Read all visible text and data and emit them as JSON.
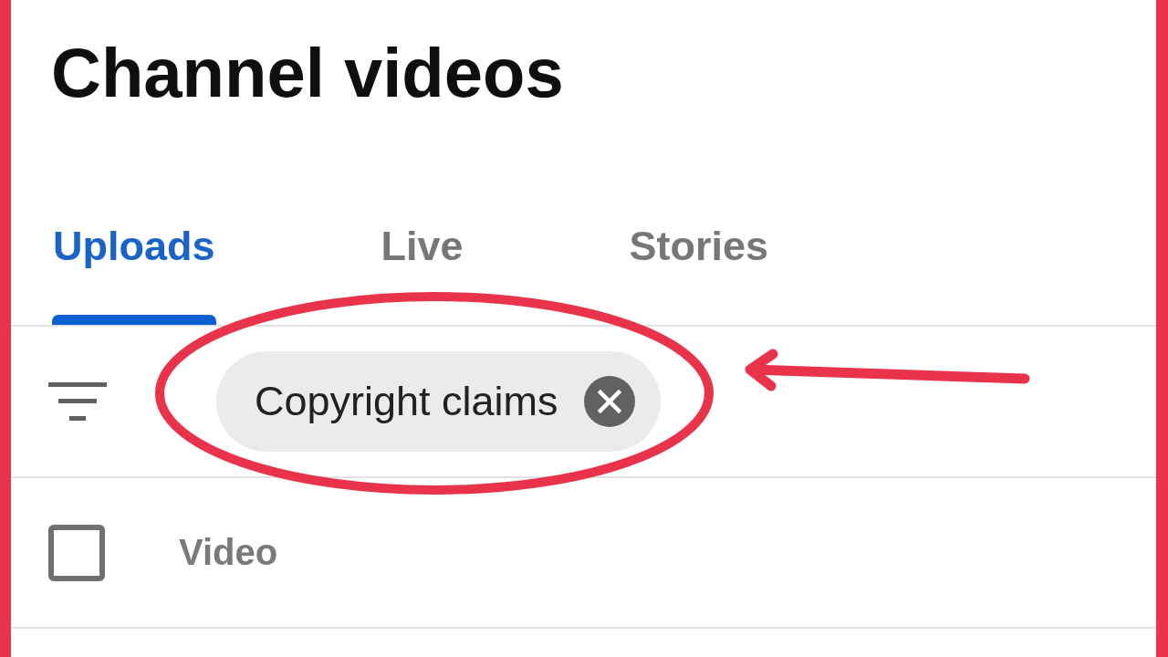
{
  "title": "Channel videos",
  "tabs": [
    {
      "label": "Uploads",
      "selected": true
    },
    {
      "label": "Live",
      "selected": false
    },
    {
      "label": "Stories",
      "selected": false
    }
  ],
  "filter_bar": {
    "chips": [
      {
        "label": "Copyright claims"
      }
    ]
  },
  "table": {
    "select_all": {
      "checked": false
    },
    "columns": [
      {
        "label": "Video"
      }
    ]
  }
}
